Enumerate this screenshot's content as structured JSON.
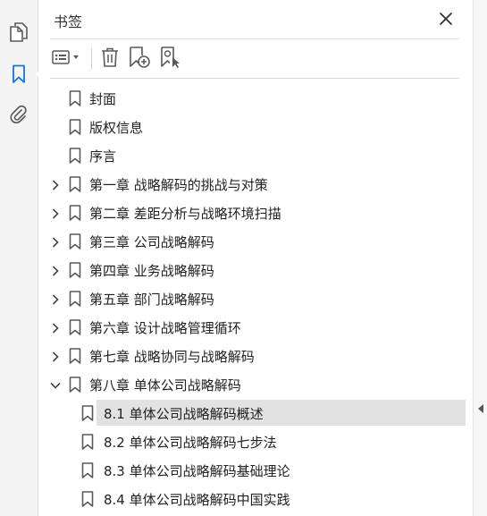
{
  "panel": {
    "title": "书签"
  },
  "rail": {
    "icons": [
      "pages-icon",
      "bookmark-icon",
      "attachment-icon"
    ],
    "accent": "#1473e6"
  },
  "toolbar": {
    "icons": [
      "options-menu-icon",
      "delete-icon",
      "new-bookmark-icon",
      "find-bookmark-icon"
    ]
  },
  "bookmarks": [
    {
      "label": "封面",
      "expandable": false
    },
    {
      "label": "版权信息",
      "expandable": false
    },
    {
      "label": "序言",
      "expandable": false
    },
    {
      "label": "第一章 战略解码的挑战与对策",
      "expandable": true
    },
    {
      "label": "第二章 差距分析与战略环境扫描",
      "expandable": true
    },
    {
      "label": "第三章 公司战略解码",
      "expandable": true
    },
    {
      "label": "第四章 业务战略解码",
      "expandable": true
    },
    {
      "label": "第五章 部门战略解码",
      "expandable": true
    },
    {
      "label": "第六章 设计战略管理循环",
      "expandable": true
    },
    {
      "label": "第七章 战略协同与战略解码",
      "expandable": true
    },
    {
      "label": "第八章 单体公司战略解码",
      "expandable": true,
      "expanded": true,
      "children": [
        {
          "label": "8.1 单体公司战略解码概述",
          "selected": true
        },
        {
          "label": "8.2 单体公司战略解码七步法"
        },
        {
          "label": "8.3 单体公司战略解码基础理论"
        },
        {
          "label": "8.4 单体公司战略解码中国实践"
        }
      ]
    }
  ],
  "colors": {
    "selected_bg": "#e2e2e2",
    "icon_gray": "#5a5a5a"
  }
}
